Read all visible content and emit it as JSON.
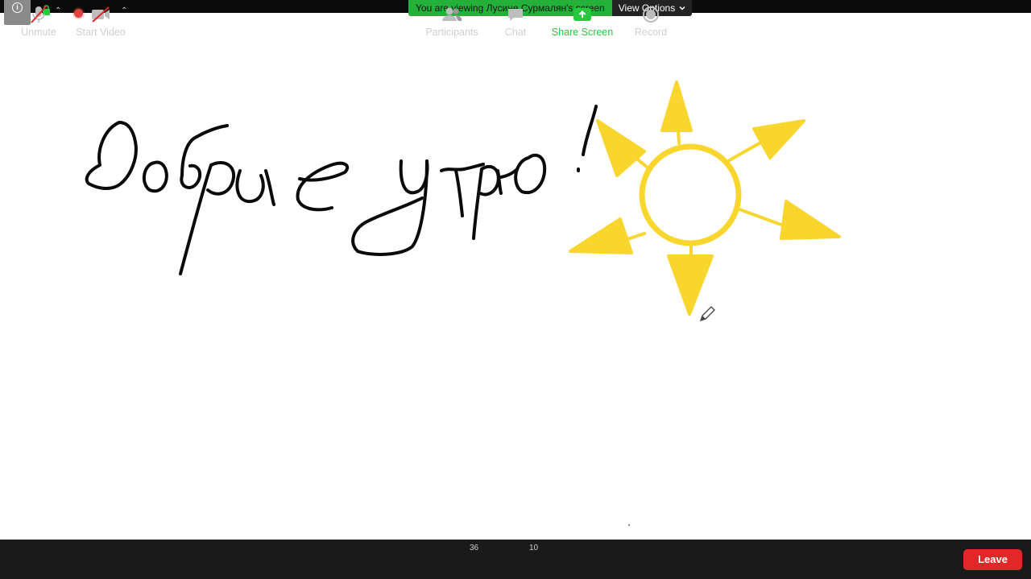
{
  "banner": {
    "viewing_text": "You are viewing Лусине Сурмалян's screen",
    "view_options_label": "View Options"
  },
  "toolbar": {
    "unmute_label": "Unmute",
    "start_video_label": "Start Video",
    "participants_label": "Participants",
    "participants_count": "36",
    "chat_label": "Chat",
    "chat_count": "10",
    "share_screen_label": "Share Screen",
    "record_label": "Record",
    "leave_label": "Leave"
  },
  "colors": {
    "banner_green": "#23b13a",
    "share_green": "#27c93f",
    "leave_red": "#e02828",
    "sun_yellow": "#f9d62e",
    "ink": "#0a0a0a"
  }
}
